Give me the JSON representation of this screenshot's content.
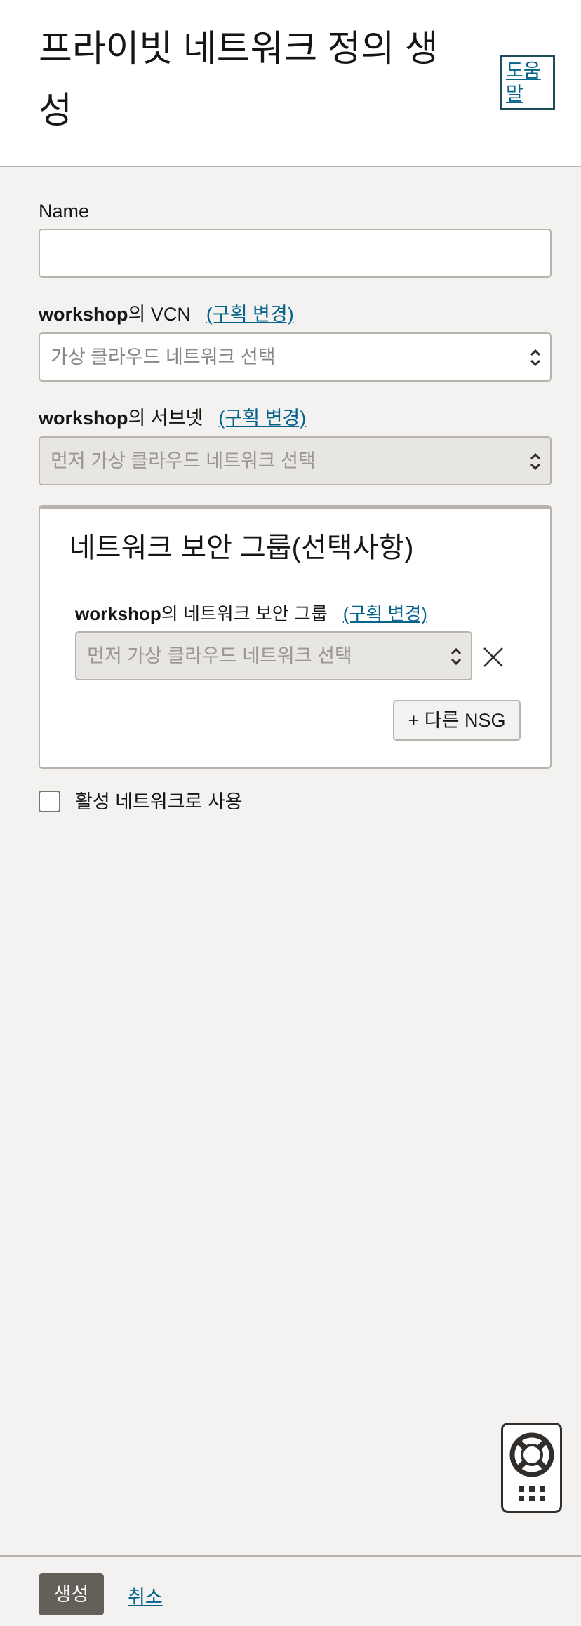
{
  "header": {
    "title": "프라이빗 네트워크 정의 생성",
    "help_label": "도움말"
  },
  "form": {
    "name_label": "Name",
    "name_value": "",
    "vcn": {
      "compartment": "workshop",
      "label_suffix": "의 VCN",
      "change_link": "(구획 변경)",
      "placeholder": "가상 클라우드 네트워크 선택"
    },
    "subnet": {
      "compartment": "workshop",
      "label_suffix": "의 서브넷",
      "change_link": "(구획 변경)",
      "placeholder": "먼저 가상 클라우드 네트워크 선택"
    },
    "nsg_panel": {
      "title": "네트워크 보안 그룹(선택사항)",
      "compartment": "workshop",
      "label_suffix": "의 네트워크 보안 그룹",
      "change_link": "(구획 변경)",
      "placeholder": "먼저 가상 클라우드 네트워크 선택",
      "add_button": "+ 다른 NSG"
    },
    "active_network_label": "활성 네트워크로 사용",
    "active_network_checked": false
  },
  "footer": {
    "create_label": "생성",
    "cancel_label": "취소"
  },
  "icons": {
    "select_chevron": "chevron-up-down-icon",
    "clear": "close-icon",
    "help_widget": "lifebuoy-icon",
    "help_widget_grid": "grid-dots-icon"
  },
  "colors": {
    "link": "#04638b",
    "primary_button": "#655f5a",
    "background": "#f3f2f0"
  }
}
